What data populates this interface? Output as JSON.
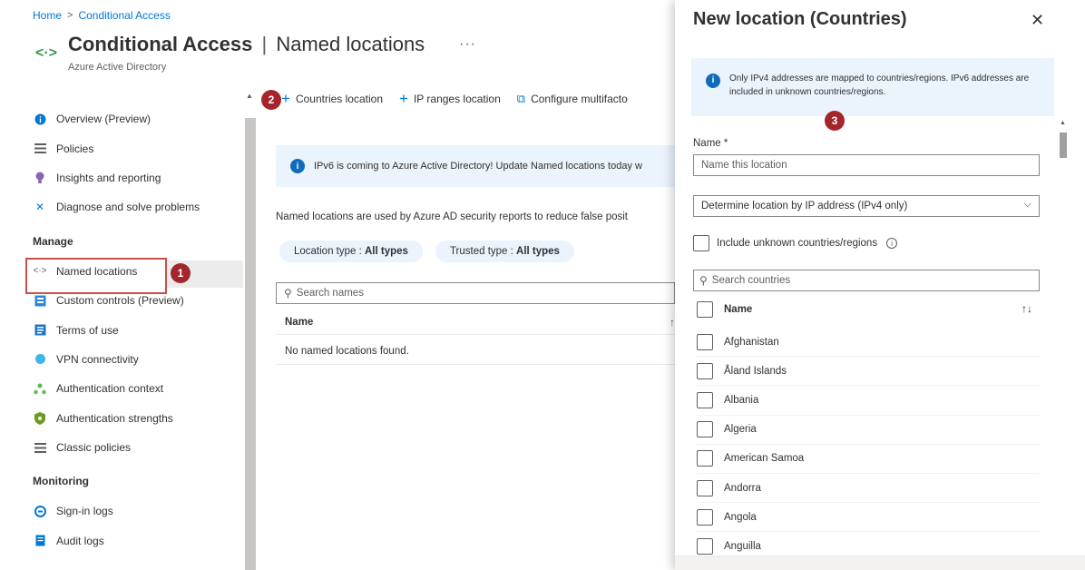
{
  "breadcrumb": {
    "items": [
      "Home",
      "Conditional Access"
    ],
    "separator": ">"
  },
  "header": {
    "title_main": "Conditional Access",
    "title_separator": "|",
    "title_sub": "Named locations",
    "subtitle": "Azure Active Directory",
    "more": "···",
    "icon": "conditional-access-icon"
  },
  "sidebar": {
    "items": [
      {
        "label": "Overview (Preview)",
        "icon": "info-icon",
        "color": "#0078d4"
      },
      {
        "label": "Policies",
        "icon": "list-icon",
        "color": "#605e5c"
      },
      {
        "label": "Insights and reporting",
        "icon": "bulb-icon",
        "color": "#8764b8"
      },
      {
        "label": "Diagnose and solve problems",
        "icon": "wrench-icon",
        "color": "#0078d4"
      }
    ],
    "manage_heading": "Manage",
    "manage_items": [
      {
        "label": "Named locations",
        "icon": "location-icon",
        "selected": true
      },
      {
        "label": "Custom controls (Preview)",
        "icon": "controls-icon"
      },
      {
        "label": "Terms of use",
        "icon": "terms-icon"
      },
      {
        "label": "VPN connectivity",
        "icon": "vpn-icon"
      },
      {
        "label": "Authentication context",
        "icon": "auth-context-icon"
      },
      {
        "label": "Authentication strengths",
        "icon": "shield-icon"
      },
      {
        "label": "Classic policies",
        "icon": "list-icon"
      }
    ],
    "monitoring_heading": "Monitoring",
    "monitoring_items": [
      {
        "label": "Sign-in logs",
        "icon": "signin-icon"
      },
      {
        "label": "Audit logs",
        "icon": "audit-icon"
      }
    ]
  },
  "badges": {
    "one": "1",
    "two": "2",
    "three": "3"
  },
  "toolbar": {
    "countries_location": "Countries location",
    "ip_ranges_location": "IP ranges location",
    "configure_mfa": "Configure multifacto"
  },
  "main": {
    "info_text": "IPv6 is coming to Azure Active Directory! Update Named locations today w",
    "description": "Named locations are used by Azure AD security reports to reduce false posit",
    "filter_location_type": {
      "label": "Location type : ",
      "value": "All types"
    },
    "filter_trusted_type": {
      "label": "Trusted type : ",
      "value": "All types"
    },
    "search_placeholder": "Search names",
    "table_header_name": "Name",
    "empty_message": "No named locations found."
  },
  "panel": {
    "title": "New location (Countries)",
    "close": "✕",
    "info_text": "Only IPv4 addresses are mapped to countries/regions. IPv6 addresses are included in unknown countries/regions.",
    "name_label": "Name *",
    "name_placeholder": "Name this location",
    "determine_select": "Determine location by IP address (IPv4 only)",
    "include_unknown_label": "Include unknown countries/regions",
    "search_placeholder": "Search countries",
    "list_header": "Name",
    "countries": [
      "Afghanistan",
      "Åland Islands",
      "Albania",
      "Algeria",
      "American Samoa",
      "Andorra",
      "Angola",
      "Anguilla"
    ]
  },
  "colors": {
    "accent": "#0078d4",
    "badge": "#a4262c",
    "highlight_border": "#c9504a",
    "info_background": "#ebf3fc"
  }
}
